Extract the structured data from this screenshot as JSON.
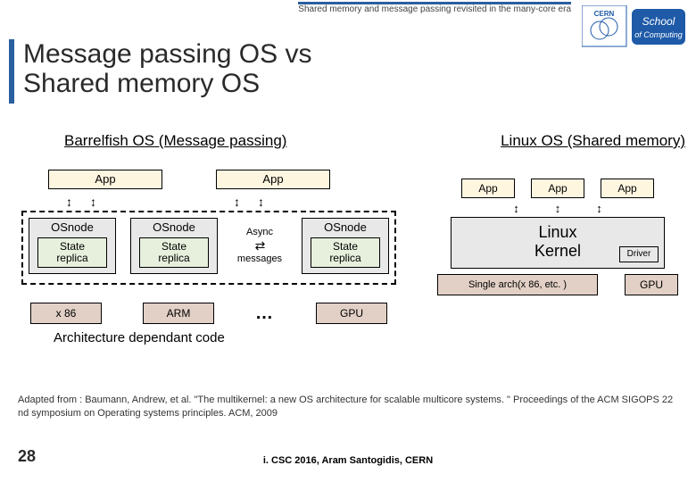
{
  "header": {
    "running_title": "Shared memory and message passing revisited in the many-core era",
    "logo_primary": "CERN",
    "logo_secondary": "School of Computing"
  },
  "title_line1": "Message passing OS vs",
  "title_line2": "Shared memory OS",
  "subtitles": {
    "left": "Barrelfish OS (Message passing)",
    "right": "Linux OS (Shared memory)"
  },
  "barrelfish": {
    "app_label": "App",
    "osnode_label": "OSnode",
    "state_line1": "State",
    "state_line2": "replica",
    "msg_line1": "Async",
    "msg_line2": "messages",
    "arch": {
      "a": "x 86",
      "b": "ARM",
      "c": "GPU",
      "dots": "…"
    },
    "arch_caption": "Architecture dependant code"
  },
  "linux": {
    "app_label": "App",
    "kernel_line1": "Linux",
    "kernel_line2": "Kernel",
    "driver": "Driver",
    "single_arch": "Single arch(x 86, etc. )",
    "gpu": "GPU"
  },
  "citation": "Adapted from : Baumann, Andrew, et al. \"The multikernel: a new OS architecture for scalable multicore systems. \" Proceedings of the ACM SIGOPS 22 nd symposium on Operating systems principles. ACM, 2009",
  "page_number": "28",
  "footer": "i. CSC 2016, Aram Santogidis, CERN"
}
